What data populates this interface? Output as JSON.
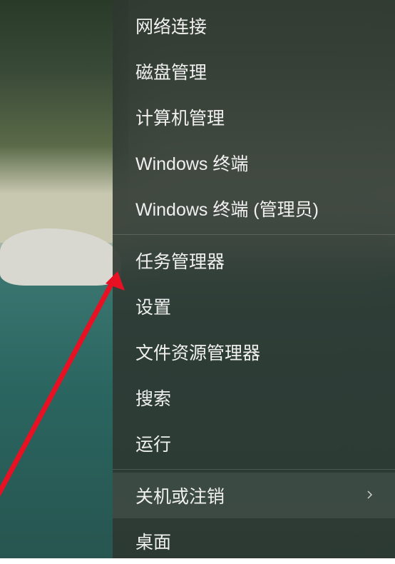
{
  "menu": {
    "groups": [
      {
        "items": [
          {
            "id": "network-connections",
            "label": "网络连接",
            "hasSubmenu": false
          },
          {
            "id": "disk-management",
            "label": "磁盘管理",
            "hasSubmenu": false
          },
          {
            "id": "computer-management",
            "label": "计算机管理",
            "hasSubmenu": false
          },
          {
            "id": "windows-terminal",
            "label": "Windows 终端",
            "hasSubmenu": false
          },
          {
            "id": "windows-terminal-admin",
            "label": "Windows 终端 (管理员)",
            "hasSubmenu": false
          }
        ]
      },
      {
        "items": [
          {
            "id": "task-manager",
            "label": "任务管理器",
            "hasSubmenu": false
          },
          {
            "id": "settings",
            "label": "设置",
            "hasSubmenu": false
          },
          {
            "id": "file-explorer",
            "label": "文件资源管理器",
            "hasSubmenu": false
          },
          {
            "id": "search",
            "label": "搜索",
            "hasSubmenu": false
          },
          {
            "id": "run",
            "label": "运行",
            "hasSubmenu": false
          }
        ]
      },
      {
        "items": [
          {
            "id": "shutdown-signout",
            "label": "关机或注销",
            "hasSubmenu": true,
            "highlighted": true
          },
          {
            "id": "desktop",
            "label": "桌面",
            "hasSubmenu": false
          }
        ]
      }
    ]
  },
  "annotation": {
    "arrowColor": "#e81123"
  }
}
